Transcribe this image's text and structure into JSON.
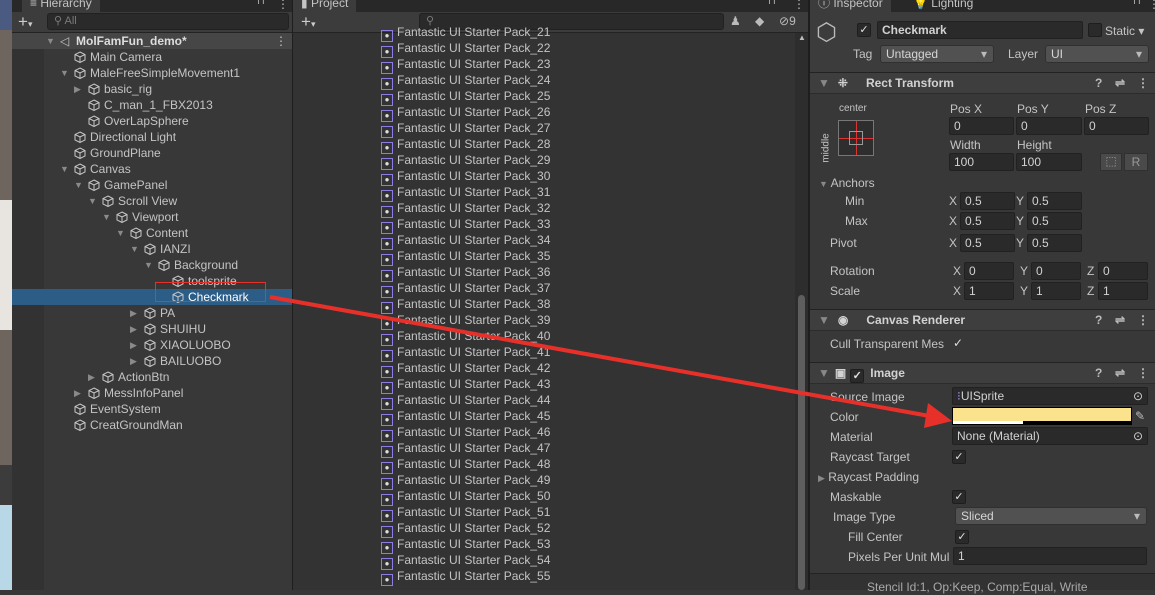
{
  "hierarchy": {
    "tab": "Hierarchy",
    "search_placeholder": "All",
    "selected": "Checkmark",
    "items": [
      {
        "label": "MolFamFun_demo*",
        "level": -1,
        "arrow": "open",
        "scene": true
      },
      {
        "label": "Main Camera",
        "level": 0,
        "arrow": "none"
      },
      {
        "label": "MaleFreeSimpleMovement1",
        "level": 0,
        "arrow": "open"
      },
      {
        "label": "basic_rig",
        "level": 1,
        "arrow": "closed"
      },
      {
        "label": "C_man_1_FBX2013",
        "level": 1,
        "arrow": "none"
      },
      {
        "label": "OverLapSphere",
        "level": 1,
        "arrow": "none"
      },
      {
        "label": "Directional Light",
        "level": 0,
        "arrow": "none"
      },
      {
        "label": "GroundPlane",
        "level": 0,
        "arrow": "none"
      },
      {
        "label": "Canvas",
        "level": 0,
        "arrow": "open"
      },
      {
        "label": "GamePanel",
        "level": 1,
        "arrow": "open"
      },
      {
        "label": "Scroll View",
        "level": 2,
        "arrow": "open"
      },
      {
        "label": "Viewport",
        "level": 3,
        "arrow": "open"
      },
      {
        "label": "Content",
        "level": 4,
        "arrow": "open"
      },
      {
        "label": "IANZI",
        "level": 5,
        "arrow": "open"
      },
      {
        "label": "Background",
        "level": 6,
        "arrow": "open"
      },
      {
        "label": "toolsprite",
        "level": 7,
        "arrow": "none"
      },
      {
        "label": "Checkmark",
        "level": 7,
        "arrow": "none"
      },
      {
        "label": "PA",
        "level": 5,
        "arrow": "closed"
      },
      {
        "label": "SHUIHU",
        "level": 5,
        "arrow": "closed"
      },
      {
        "label": "XIAOLUOBO",
        "level": 5,
        "arrow": "closed"
      },
      {
        "label": "BAILUOBO",
        "level": 5,
        "arrow": "closed"
      },
      {
        "label": "ActionBtn",
        "level": 2,
        "arrow": "closed"
      },
      {
        "label": "MessInfoPanel",
        "level": 1,
        "arrow": "closed"
      },
      {
        "label": "EventSystem",
        "level": 0,
        "arrow": "none"
      },
      {
        "label": "CreatGroundMan",
        "level": 0,
        "arrow": "none"
      }
    ]
  },
  "project": {
    "tab": "Project",
    "hidden_count": "9",
    "items": [
      "Fantastic UI Starter Pack_21",
      "Fantastic UI Starter Pack_22",
      "Fantastic UI Starter Pack_23",
      "Fantastic UI Starter Pack_24",
      "Fantastic UI Starter Pack_25",
      "Fantastic UI Starter Pack_26",
      "Fantastic UI Starter Pack_27",
      "Fantastic UI Starter Pack_28",
      "Fantastic UI Starter Pack_29",
      "Fantastic UI Starter Pack_30",
      "Fantastic UI Starter Pack_31",
      "Fantastic UI Starter Pack_32",
      "Fantastic UI Starter Pack_33",
      "Fantastic UI Starter Pack_34",
      "Fantastic UI Starter Pack_35",
      "Fantastic UI Starter Pack_36",
      "Fantastic UI Starter Pack_37",
      "Fantastic UI Starter Pack_38",
      "Fantastic UI Starter Pack_39",
      "Fantastic UI Starter Pack_40",
      "Fantastic UI Starter Pack_41",
      "Fantastic UI Starter Pack_42",
      "Fantastic UI Starter Pack_43",
      "Fantastic UI Starter Pack_44",
      "Fantastic UI Starter Pack_45",
      "Fantastic UI Starter Pack_46",
      "Fantastic UI Starter Pack_47",
      "Fantastic UI Starter Pack_48",
      "Fantastic UI Starter Pack_49",
      "Fantastic UI Starter Pack_50",
      "Fantastic UI Starter Pack_51",
      "Fantastic UI Starter Pack_52",
      "Fantastic UI Starter Pack_53",
      "Fantastic UI Starter Pack_54",
      "Fantastic UI Starter Pack_55"
    ]
  },
  "inspector": {
    "tab": "Inspector",
    "tab2": "Lighting",
    "name": "Checkmark",
    "static": "Static",
    "tag_label": "Tag",
    "tag": "Untagged",
    "layer_label": "Layer",
    "layer": "UI",
    "rect": {
      "title": "Rect Transform",
      "anchor_h": "center",
      "anchor_v": "middle",
      "posx_l": "Pos X",
      "posy_l": "Pos Y",
      "posz_l": "Pos Z",
      "posx": "0",
      "posy": "0",
      "posz": "0",
      "width_l": "Width",
      "height_l": "Height",
      "width": "100",
      "height": "100",
      "r": "R",
      "anchors": "Anchors",
      "min": "Min",
      "max": "Max",
      "pivot": "Pivot",
      "x": "X",
      "y": "Y",
      "z": "Z",
      "min_x": "0.5",
      "min_y": "0.5",
      "max_x": "0.5",
      "max_y": "0.5",
      "pivot_x": "0.5",
      "pivot_y": "0.5",
      "rotation": "Rotation",
      "scale": "Scale",
      "rot_x": "0",
      "rot_y": "0",
      "rot_z": "0",
      "sc_x": "1",
      "sc_y": "1",
      "sc_z": "1"
    },
    "canvas_renderer": {
      "title": "Canvas Renderer",
      "cull": "Cull Transparent Mes"
    },
    "image": {
      "title": "Image",
      "source_l": "Source Image",
      "source": "UISprite",
      "color_l": "Color",
      "color": "#fbe38e",
      "material_l": "Material",
      "material": "None (Material)",
      "raycast_target": "Raycast Target",
      "raycast_padding": "Raycast Padding",
      "maskable": "Maskable",
      "type_l": "Image Type",
      "type": "Sliced",
      "fill_center": "Fill Center",
      "ppu_l": "Pixels Per Unit Mul",
      "ppu": "1"
    },
    "footer": "Stencil Id:1, Op:Keep, Comp:Equal, Write"
  }
}
